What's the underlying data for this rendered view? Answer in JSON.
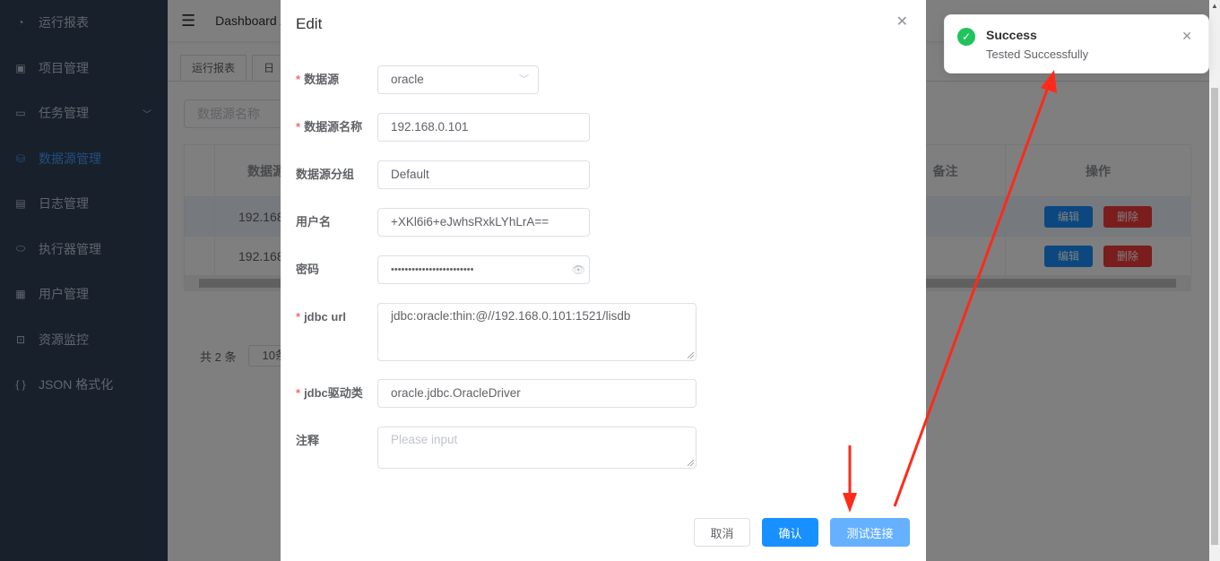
{
  "sidebar": {
    "items": [
      {
        "icon": "dashboard-icon",
        "label": "运行报表"
      },
      {
        "icon": "project-icon",
        "label": "项目管理"
      },
      {
        "icon": "monitor-icon",
        "label": "任务管理",
        "has_children": true
      },
      {
        "icon": "database-icon",
        "label": "数据源管理",
        "active": true
      },
      {
        "icon": "log-icon",
        "label": "日志管理"
      },
      {
        "icon": "executor-icon",
        "label": "执行器管理"
      },
      {
        "icon": "user-table-icon",
        "label": "用户管理"
      },
      {
        "icon": "resource-monitor-icon",
        "label": "资源监控"
      },
      {
        "icon": "braces-icon",
        "label": "JSON 格式化"
      }
    ]
  },
  "navbar": {
    "breadcrumb": "Dashboard /"
  },
  "tags": [
    "运行报表",
    "日"
  ],
  "search": {
    "placeholder": "数据源名称"
  },
  "table": {
    "headers": [
      "数据源",
      "备注",
      "操作"
    ],
    "rows": [
      {
        "name": "192.168"
      },
      {
        "name": "192.168"
      }
    ],
    "edit_label": "编辑",
    "delete_label": "删除"
  },
  "pager": {
    "total": "共 2 条",
    "page_size": "10条"
  },
  "dialog": {
    "title": "Edit",
    "fields": [
      {
        "label": "数据源",
        "required": true,
        "value": "oracle",
        "type": "select"
      },
      {
        "label": "数据源名称",
        "required": true,
        "value": "192.168.0.101"
      },
      {
        "label": "数据源分组",
        "required": false,
        "value": "Default"
      },
      {
        "label": "用户名",
        "required": false,
        "value": "+XKl6i6+eJwhsRxkLYhLrA=="
      },
      {
        "label": "密码",
        "required": false,
        "value": "••••••••••••••••••••••••",
        "type": "password"
      },
      {
        "label": "jdbc url",
        "required": true,
        "value": "jdbc:oracle:thin:@//192.168.0.101:1521/lisdb",
        "type": "textarea"
      },
      {
        "label": "jdbc驱动类",
        "required": true,
        "value": "oracle.jdbc.OracleDriver"
      },
      {
        "label": "注释",
        "required": false,
        "placeholder": "Please input",
        "type": "textarea"
      }
    ],
    "cancel": "取消",
    "confirm": "确认",
    "test": "测试连接"
  },
  "notification": {
    "title": "Success",
    "message": "Tested Successfully",
    "type": "success"
  },
  "colors": {
    "primary": "#1890ff",
    "test_button": "#66b1ff",
    "success": "#1fc45c",
    "annotation_arrow": "#ff2a1a",
    "sidebar": "#304156"
  }
}
